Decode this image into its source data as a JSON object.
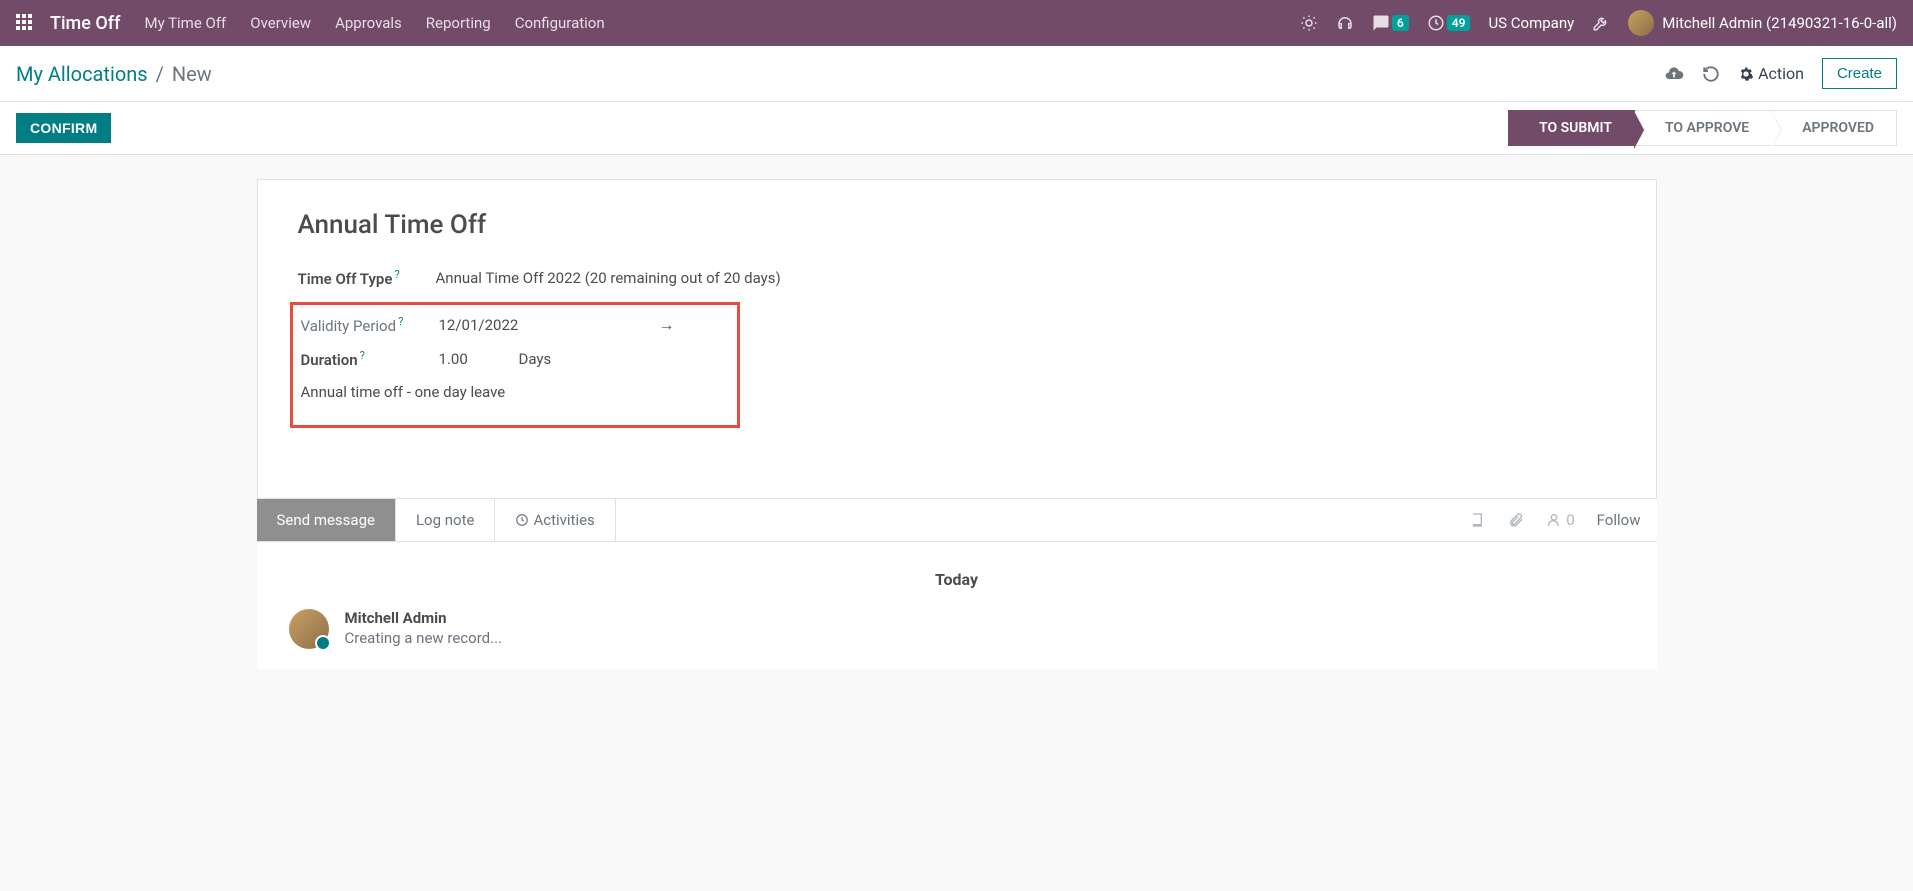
{
  "navbar": {
    "brand": "Time Off",
    "links": [
      "My Time Off",
      "Overview",
      "Approvals",
      "Reporting",
      "Configuration"
    ],
    "msg_count": "6",
    "activity_count": "49",
    "company": "US Company",
    "user": "Mitchell Admin (21490321-16-0-all)"
  },
  "breadcrumb": {
    "parent": "My Allocations",
    "current": "New"
  },
  "cp": {
    "action_label": "Action",
    "create_label": "Create"
  },
  "statusbar": {
    "confirm": "CONFIRM",
    "steps": [
      "TO SUBMIT",
      "TO APPROVE",
      "APPROVED"
    ]
  },
  "form": {
    "title": "Annual Time Off",
    "type_label": "Time Off Type",
    "type_value": "Annual Time Off 2022 (20 remaining out of 20 days)",
    "validity_label": "Validity Period",
    "validity_from": "12/01/2022",
    "duration_label": "Duration",
    "duration_value": "1.00",
    "duration_unit": "Days",
    "notes": "Annual time off - one day leave"
  },
  "chatter": {
    "send_message": "Send message",
    "log_note": "Log note",
    "activities": "Activities",
    "follower_count": "0",
    "follow": "Follow",
    "today": "Today",
    "msg_author": "Mitchell Admin",
    "msg_body": "Creating a new record..."
  }
}
